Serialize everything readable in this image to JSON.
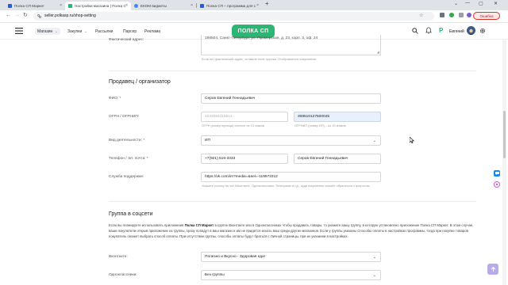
{
  "browser": {
    "tabs": [
      {
        "title": "Полка СП Маркет",
        "active": false,
        "favicon_color": "#2a5bd7"
      },
      {
        "title": "Настройки магазина | Полка С",
        "active": true,
        "favicon_color": "#2bb673"
      },
      {
        "title": "ЕКОМ виджеты",
        "active": false,
        "favicon_color": "#4285f4"
      },
      {
        "title": "Полка СП – программа для с",
        "active": false,
        "favicon_color": "#2a5bd7"
      }
    ],
    "new_tab": "+",
    "url": "seller.polkasp.ru/shop-setting",
    "error_label": "Ошибка",
    "window_controls": {
      "minimize": "—",
      "maximize": "▢",
      "close": "✕",
      "tab_search": "⌄"
    }
  },
  "site_nav": {
    "items": [
      {
        "label": "Магазин",
        "dropdown": true,
        "active": true
      },
      {
        "label": "Закупки",
        "dropdown": true,
        "active": false
      },
      {
        "label": "Рассылки",
        "dropdown": false,
        "active": false
      },
      {
        "label": "Парсер",
        "dropdown": false,
        "active": false
      },
      {
        "label": "Реклама",
        "dropdown": false,
        "active": false
      }
    ],
    "logo": "ПОЛКА СП",
    "p_badge": "P",
    "user_name": "Евгений"
  },
  "form": {
    "address": {
      "label": "Фактический адрес:",
      "value": "198504, Санкт-Петербург, ул. Примерская, д. 23, корп. 3, оф. 24",
      "hint": "Если нет фактический адрес, оставьте поле пустым. Отображается покупателю"
    },
    "seller_heading": "Продавец / организатор",
    "fio": {
      "label": "ФИО: *",
      "value": "Серов Евгений Геннадьевич"
    },
    "ogrn": {
      "label": "ОГРН / ОГРНИП:",
      "ogrn_placeholder": "1231554415614",
      "ogrnip_value": "308510127500045",
      "ogrn_hint": "ОГРН (номер юрлица) состоит из 13 знаков",
      "ogrnip_hint": "ОГРНИП (номер ИП) – из 15 знаков"
    },
    "activity": {
      "label": "Вид деятельности: *",
      "value": "ИП"
    },
    "contact": {
      "label": "Телефон / Эл. почта: *",
      "phone": "+7(921) 516-3333",
      "name": "Серов Евгений Геннадьевич"
    },
    "support": {
      "label": "Служба поддержки:",
      "value": "https://vk.com/im?media=&sel=-119973312",
      "hint": "Укажите ссылку на чат ВКонтакте, Одноклассники, Телеграмм и т.д., куда покупатель сможет обратиться с вопросом"
    },
    "social_heading": "Группа в соцсети",
    "social_text": {
      "before": "Если вы планируете использовать приложения ",
      "bold": "Полка СП Маркет",
      "after": " в группе Вконтакте или в Одноклассниках чтобы продавать товары, то укажите вашу группу, в которую установлено приложение Полка СП Маркет. В этом случае, ваши покупатели открыв приложение из группы, сразу попадут в ваш магазин и им не придется искать ваш среди других магазинов. Если у группы указаны Способы оплаты в настройках программы, тогда при покупке товаров покупатель сможет выбрать способ оплаты. При отсутствии группы, способы оплаты будут браться с Личной страницы, при их указании в настройках."
    },
    "vk": {
      "label": "Вконтакте:",
      "value": "Полезно и Вкусно - Здоровая еда!"
    },
    "ok": {
      "label": "Одноклассники:",
      "value": "Без группы"
    }
  },
  "colors": {
    "brand": "#2bb673",
    "field_filled": "#e8f0fe",
    "error": "#d93025",
    "to_top": "#b9aae9"
  }
}
